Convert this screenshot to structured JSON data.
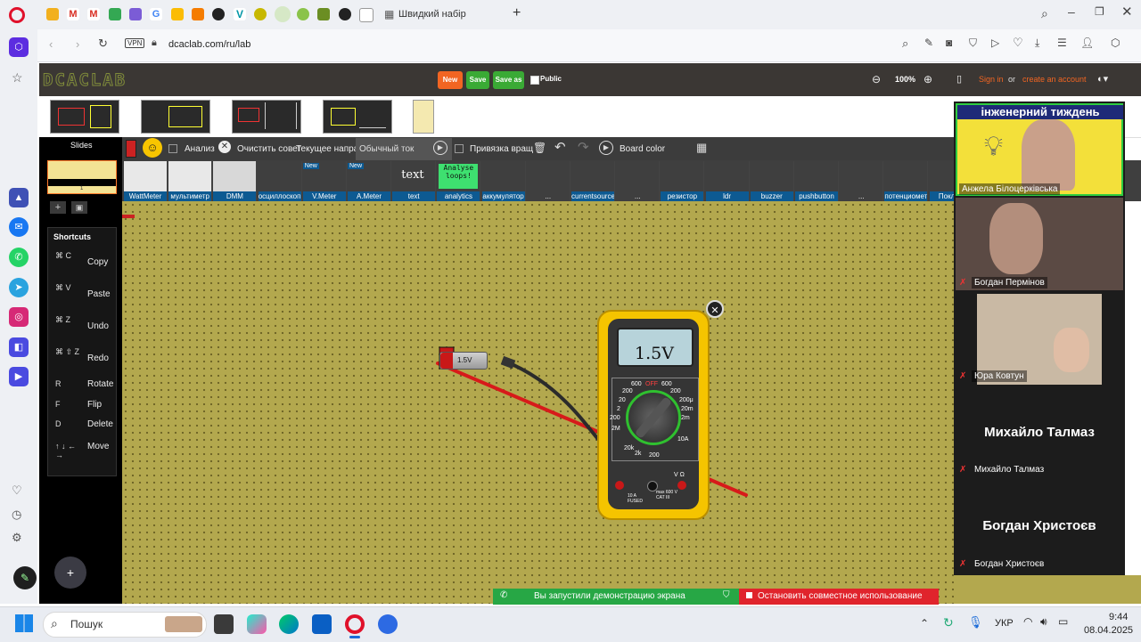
{
  "browser": {
    "tab_title": "Швидкий набір",
    "url": "dcaclab.com/ru/lab",
    "vpn": "VPN"
  },
  "app": {
    "logo": "DCACLAB",
    "buttons": {
      "new": "New",
      "save": "Save",
      "save_as": "Save as",
      "public": "Public"
    },
    "zoom": "100%",
    "sign_in": "Sign in",
    "or": "or",
    "create_account": "create an account",
    "accent": "#f26522"
  },
  "left_panel": {
    "slides_label": "Slides",
    "slide_number": "1",
    "shortcuts_title": "Shortcuts",
    "shortcuts": [
      {
        "keys": "⌘ C",
        "label": "Copy"
      },
      {
        "keys": "⌘ V",
        "label": "Paste"
      },
      {
        "keys": "⌘ Z",
        "label": "Undo"
      },
      {
        "keys": "⌘ ⇧ Z",
        "label": "Redo"
      },
      {
        "keys": "R",
        "label": "Rotate"
      },
      {
        "keys": "F",
        "label": "Flip"
      },
      {
        "keys": "D",
        "label": "Delete"
      },
      {
        "keys": "↑ ↓ ← →",
        "label": "Move"
      }
    ]
  },
  "toolbar": {
    "analysis": "Анализ",
    "clear": "Очистить совет",
    "current_dir": "Текущее направ",
    "normal_current": "Обычный ток",
    "snap": "Привязка вращ",
    "board_color": "Board color"
  },
  "components": [
    {
      "label": "WattMeter",
      "new": false
    },
    {
      "label": "мультиметр",
      "new": false
    },
    {
      "label": "DMM",
      "new": false
    },
    {
      "label": "осциллоскоп",
      "new": false
    },
    {
      "label": "V.Meter",
      "new": true
    },
    {
      "label": "A.Meter",
      "new": true
    },
    {
      "label": "text",
      "new": false
    },
    {
      "label": "analytics",
      "new": false
    },
    {
      "label": "аккумулятор",
      "new": false
    },
    {
      "label": "...",
      "new": false
    },
    {
      "label": "currentsource",
      "new": false
    },
    {
      "label": "...",
      "new": false
    },
    {
      "label": "резистор",
      "new": false
    },
    {
      "label": "ldr",
      "new": false
    },
    {
      "label": "buzzer",
      "new": false
    },
    {
      "label": "pushbutton",
      "new": false
    },
    {
      "label": "...",
      "new": false
    },
    {
      "label": "потенциометр",
      "new": false
    },
    {
      "label": "Поклон",
      "new": false
    }
  ],
  "components_extra": {
    "text_icon": "text",
    "analytics_icon": "Analyse loops!",
    "new_badge": "New"
  },
  "board": {
    "battery_label": "1.5V",
    "multimeter_reading": "1.5V",
    "dial": {
      "off": "OFF",
      "top": [
        "600",
        "600"
      ],
      "left": [
        "200",
        "20",
        "2",
        "200",
        "2M",
        "20k",
        "2k"
      ],
      "right": [
        "200",
        "20m",
        "2m",
        "200μ",
        "10A"
      ],
      "bottom": "200"
    },
    "jacks": {
      "left": "10 A FUSED",
      "right": "max 600 V CAT III",
      "vohm": "V Ω"
    },
    "close_glyph": "✕"
  },
  "video": {
    "banner_text": "інженерний тиждень",
    "participants": [
      {
        "name": "Анжела Білоцерківська"
      },
      {
        "name": "Богдан Пермінов"
      },
      {
        "name": "Юра Ковтун"
      },
      {
        "name": "Михайло Талмаз",
        "big": "Михайло Талмаз"
      },
      {
        "name": "Богдан Христоєв",
        "big": "Богдан Христоєв"
      }
    ]
  },
  "share_bar": {
    "status": "Вы запустили демонстрацию экрана",
    "stop": "Остановить совместное использование"
  },
  "taskbar": {
    "search": "Пошук",
    "lang": "УКР",
    "time": "9:44",
    "date": "08.04.2025"
  }
}
